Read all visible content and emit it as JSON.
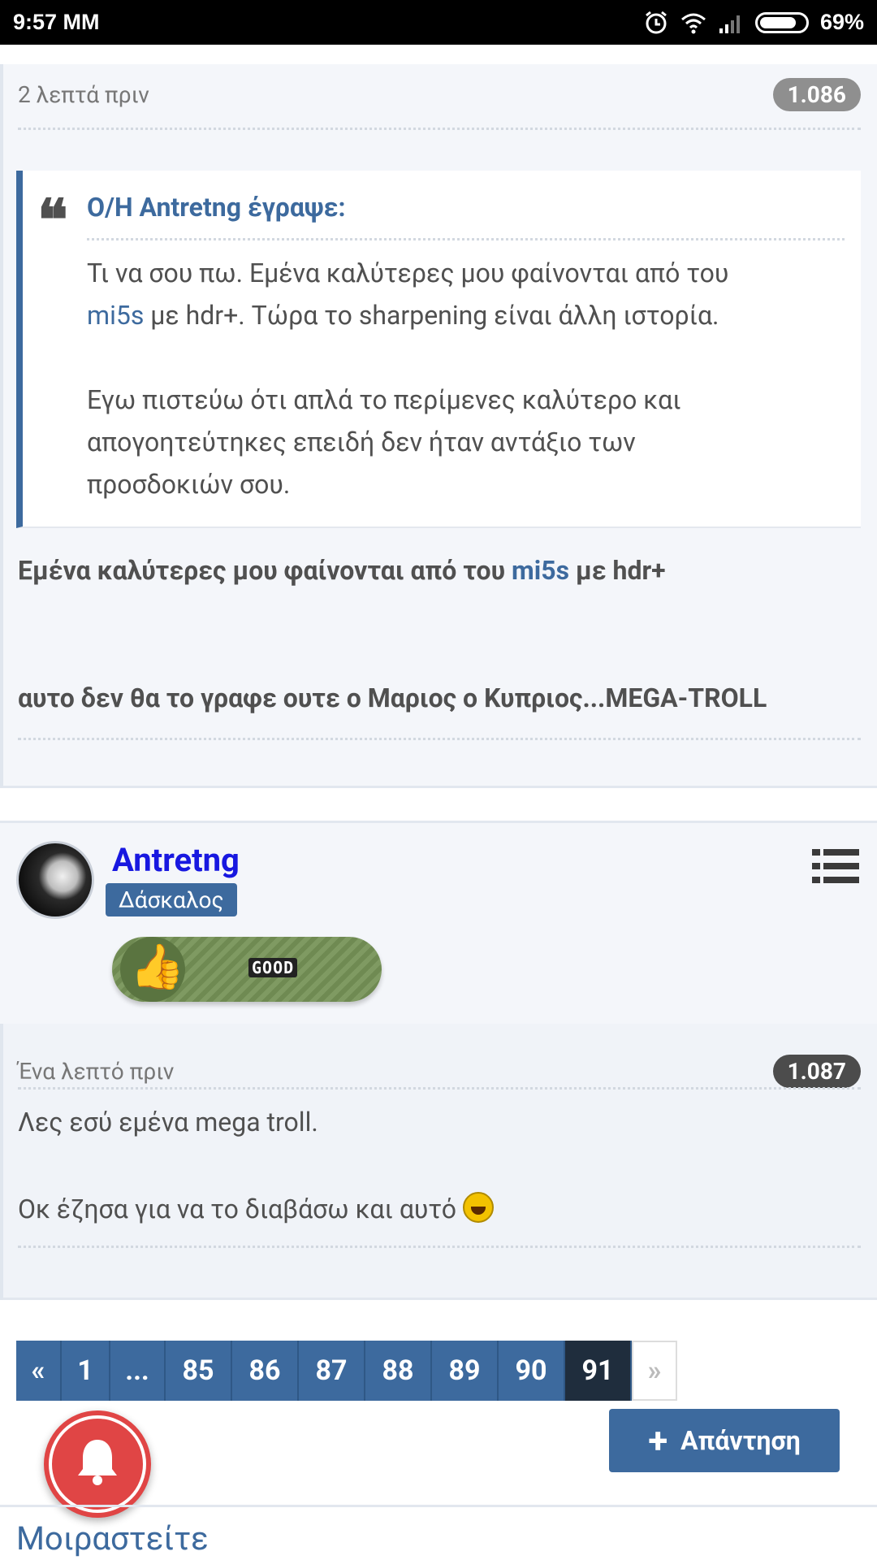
{
  "status_bar": {
    "time": "9:57 MM",
    "battery": "69%",
    "icons": [
      "alarm-icon",
      "wifi-icon",
      "signal-icon",
      "battery-icon"
    ]
  },
  "post1": {
    "time_ago": "2 λεπτά πριν",
    "number": "1.086",
    "quote": {
      "author": "Ο/Η Antretng έγραψε:",
      "line1_pre": "Τι να σου πω. Εμένα καλύτερες μου φαίνονται από του",
      "line2_link": "mi5s",
      "line2_rest": " με hdr+. Τώρα το sharpening είναι άλλη ιστορία.",
      "para2_line1": "Εγω πιστεύω ότι απλά το περίμενες καλύτερο και",
      "para2_line2": "απογοητεύτηκες επειδή δεν ήταν αντάξιο των",
      "para2_line3": "προσδοκιών σου."
    },
    "bold_line1_pre": "Εμένα καλύτερες μου φαίνονται από του ",
    "bold_line1_link": "mi5s",
    "bold_line1_post": " με hdr+",
    "bold_line2": "αυτο δεν θα το γραφε ουτε ο Μαριος ο Κυπριος...MEGA-TROLL"
  },
  "user": {
    "name": "Antretng",
    "role": "Δάσκαλος",
    "badge_text": "GOOD"
  },
  "post2": {
    "time_ago": "Ένα λεπτό πριν",
    "number": "1.087",
    "line1": "Λες εσύ εμένα mega troll.",
    "line2": "Οκ έζησα για να το διαβάσω και αυτό"
  },
  "pagination": {
    "prev": "«",
    "pages": [
      "1",
      "...",
      "85",
      "86",
      "87",
      "88",
      "89",
      "90",
      "91"
    ],
    "active": "91",
    "next": "»"
  },
  "reply_button": "Απάντηση",
  "share_title": "Μοιραστείτε",
  "colors": {
    "accent": "#3d6a9e",
    "username": "#1818e0",
    "notification": "#e04545"
  }
}
